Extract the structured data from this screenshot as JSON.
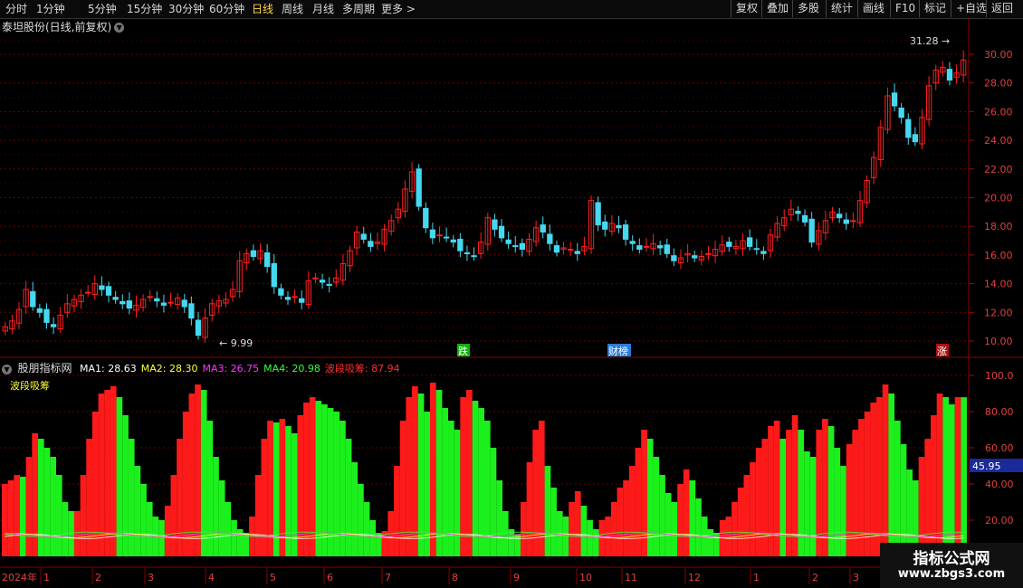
{
  "toolbar": {
    "periods": [
      "分时",
      "1分钟",
      "5分钟",
      "15分钟",
      "30分钟",
      "60分钟",
      "日线",
      "周线",
      "月线",
      "多周期",
      "更多 >"
    ],
    "active_period": "日线",
    "right_buttons": [
      "复权",
      "叠加",
      "多股",
      "统计",
      "画线",
      "F10",
      "标记",
      "+自选",
      "返回"
    ]
  },
  "stock": {
    "title": "泰坦股份(日线,前复权)"
  },
  "main_chart": {
    "y_ticks": [
      "30.00",
      "28.00",
      "26.00",
      "24.00",
      "22.00",
      "20.00",
      "18.00",
      "16.00",
      "14.00",
      "12.00",
      "10.00"
    ],
    "high_label": "31.28",
    "low_label": "9.99",
    "event_markers": [
      "跌",
      "财榜",
      "涨"
    ],
    "colors": {
      "up": "#ff2020",
      "down": "#46d8f0",
      "grid": "#7a0000"
    }
  },
  "indicator": {
    "site_name": "股朋指标网",
    "values": [
      {
        "label": "MA1:",
        "value": "28.63",
        "color": "#ffffff"
      },
      {
        "label": "MA2:",
        "value": "28.30",
        "color": "#ffff33"
      },
      {
        "label": "MA3:",
        "value": "26.75",
        "color": "#ff33ff"
      },
      {
        "label": "MA4:",
        "value": "20.98",
        "color": "#33ff33"
      },
      {
        "label": "波段吸筹:",
        "value": "87.94",
        "color": "#ff3030"
      }
    ],
    "legend_text": "波段吸筹",
    "y_ticks": [
      "100.0",
      "80.00",
      "60.00",
      "40.00",
      "20.00"
    ],
    "cursor_value": "45.95"
  },
  "date_axis": {
    "year": "2024年",
    "months": [
      "1",
      "2",
      "3",
      "4",
      "5",
      "6",
      "7",
      "8",
      "9",
      "10",
      "11",
      "12",
      "1",
      "2",
      "3"
    ]
  },
  "watermark": {
    "name": "指标公式网",
    "url": "www.zbgs3.com"
  },
  "chart_data": {
    "type": "bar",
    "title": "",
    "price_range": [
      9.99,
      31.28
    ],
    "indicator_range": [
      0,
      100
    ],
    "price_closes": [
      11.0,
      11.4,
      12.2,
      13.6,
      12.4,
      12.0,
      11.3,
      11.0,
      11.8,
      12.6,
      12.9,
      13.2,
      13.4,
      14.0,
      13.6,
      13.2,
      12.9,
      12.6,
      12.3,
      12.5,
      12.9,
      13.1,
      12.8,
      12.5,
      12.7,
      13.0,
      12.4,
      11.6,
      10.4,
      11.6,
      12.6,
      12.8,
      12.9,
      13.6,
      15.6,
      16.1,
      15.9,
      16.3,
      15.2,
      13.8,
      13.2,
      12.9,
      13.1,
      12.7,
      14.2,
      14.4,
      14.1,
      13.9,
      14.4,
      15.4,
      16.3,
      17.6,
      17.1,
      16.6,
      16.9,
      17.8,
      18.4,
      19.2,
      20.6,
      21.8,
      19.4,
      17.9,
      17.2,
      17.4,
      17.2,
      16.9,
      16.3,
      16.1,
      15.9,
      16.9,
      18.6,
      17.8,
      17.2,
      16.8,
      16.6,
      16.4,
      17.1,
      17.9,
      17.6,
      16.8,
      16.2,
      16.5,
      16.4,
      16.1,
      16.6,
      19.8,
      18.1,
      17.8,
      18.2,
      17.9,
      17.1,
      16.8,
      16.4,
      16.6,
      16.8,
      16.5,
      16.1,
      15.6,
      15.8,
      16.1,
      15.8,
      15.9,
      16.1,
      16.4,
      16.7,
      16.6,
      16.6,
      17.0,
      16.6,
      16.4,
      16.1,
      17.4,
      18.2,
      18.6,
      19.2,
      18.9,
      18.3,
      16.9,
      17.7,
      18.4,
      19.0,
      18.6,
      18.2,
      18.4,
      19.8,
      21.2,
      22.8,
      24.9,
      27.1,
      26.4,
      25.6,
      24.2,
      23.9,
      25.6,
      27.8,
      28.9,
      29.1,
      28.2,
      28.7,
      29.6
    ],
    "indicator_series": [
      40,
      42,
      45,
      44,
      55,
      68,
      65,
      60,
      55,
      45,
      30,
      25,
      25,
      45,
      65,
      80,
      90,
      92,
      94,
      88,
      78,
      65,
      50,
      40,
      30,
      22,
      20,
      28,
      45,
      65,
      80,
      90,
      95,
      92,
      75,
      55,
      42,
      30,
      20,
      15,
      13,
      22,
      45,
      65,
      75,
      74,
      76,
      72,
      68,
      78,
      85,
      88,
      86,
      84,
      82,
      80,
      75,
      65,
      52,
      40,
      30,
      20,
      13,
      14,
      25,
      50,
      75,
      88,
      94,
      90,
      80,
      96,
      92,
      82,
      75,
      70,
      88,
      92,
      86,
      82,
      75,
      60,
      42,
      25,
      15,
      12,
      30,
      52,
      70,
      75,
      50,
      38,
      25,
      22,
      30,
      36,
      28,
      20,
      15,
      20,
      22,
      30,
      38,
      42,
      50,
      60,
      70,
      65,
      55,
      45,
      35,
      30,
      40,
      48,
      42,
      32,
      22,
      15,
      13,
      20,
      22,
      30,
      38,
      45,
      52,
      60,
      65,
      72,
      75,
      65,
      70,
      78,
      70,
      58,
      55,
      70,
      76,
      72,
      60,
      50,
      62,
      70,
      76,
      80,
      85,
      88,
      95,
      90,
      75,
      62,
      48,
      42,
      55,
      65,
      78,
      90,
      88,
      84,
      88,
      87.94
    ],
    "x_labels_months": [
      "1",
      "2",
      "3",
      "4",
      "5",
      "6",
      "7",
      "8",
      "9",
      "10",
      "11",
      "12",
      "1",
      "2",
      "3"
    ]
  }
}
